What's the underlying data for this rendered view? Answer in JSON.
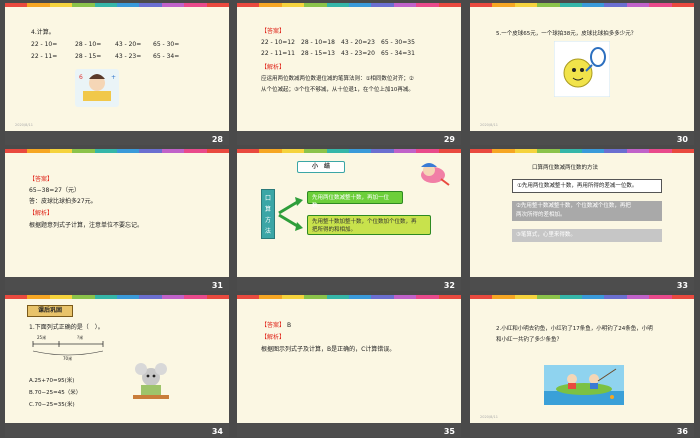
{
  "slides": [
    {
      "number": "28",
      "date": "2020/8/11",
      "heading": "4.计算。",
      "rows": [
        [
          "22 - 10=",
          "28 - 10=",
          "43 - 20=",
          "65 - 30="
        ],
        [
          "22 - 11=",
          "28 - 15=",
          "43 - 23=",
          "65 - 34="
        ]
      ]
    },
    {
      "number": "29",
      "answer_tag": "【答案】",
      "rows": [
        [
          "22 - 10=12",
          "28 - 10=18",
          "43 - 20=23",
          "65 - 30=35"
        ],
        [
          "22 - 11=11",
          "28 - 15=13",
          "43 - 23=20",
          "65 - 34=31"
        ]
      ],
      "analysis_tag": "【解析】",
      "analysis": [
        "应运用两位数减两位数退位减的笔算法则：①相同数位对齐；②",
        "从个位减起；③个位不够减，从十位退1，在个位上加10再减。"
      ]
    },
    {
      "number": "30",
      "date": "2020/8/11",
      "question": "5.一个皮球65元，一个球拍38元，皮球比球拍多多少元？"
    },
    {
      "number": "31",
      "answer_tag": "【答案】",
      "lines": [
        "65−38=27（元）",
        "答：皮球比球拍多27元。"
      ],
      "analysis_tag": "【解析】",
      "analysis": "根据题意列式子计算，注意单位不要忘记。"
    },
    {
      "number": "32",
      "title": "小　结",
      "side_label": [
        "口",
        "算",
        "方",
        "法"
      ],
      "box1": "先用两位数减整十数，再加一位数。",
      "box2": [
        "先用整十数加整十数，个位数加个位数，再",
        "把所得的和相加。"
      ]
    },
    {
      "number": "33",
      "title": "口算两位数减两位数的方法",
      "items": [
        "①先用两位数减整十数，再用所得的差减一位数。",
        "②先用整十数减整十数，个位数减个位数，再把",
        "两次所得的差相加。",
        "③笔算式，心里来得数。"
      ]
    },
    {
      "number": "34",
      "banner": "课后巩固",
      "question": "1.下面列式正确的是（　）。",
      "diagram_top": [
        "25米",
        "?米"
      ],
      "diagram_bottom": "70米",
      "options": [
        "A.25+70=95(米)",
        "B.70−25=45（米）",
        "C.70−25=35(米)"
      ]
    },
    {
      "number": "35",
      "answer_tag": "【答案】",
      "answer": "B",
      "analysis_tag": "【解析】",
      "analysis": "根据图示列式子及计算，B是正确的，C计算错误。"
    },
    {
      "number": "36",
      "date": "2020/8/11",
      "question": [
        "2.小红和小明去钓鱼，小红钓了17条鱼，小明钓了24条鱼，小明",
        "和小红一共钓了多少条鱼？"
      ]
    }
  ],
  "colors": {
    "slide_bg": "#fbf7e3",
    "bar": "#4d4d4d",
    "answer_red": "#e0261b",
    "green": "#6ccf3a",
    "teal": "#3ba6a6"
  }
}
